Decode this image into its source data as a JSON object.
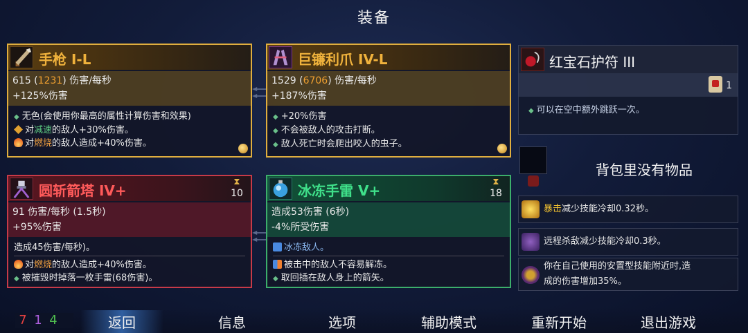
{
  "title": "装备",
  "cards": [
    {
      "name": "手枪 I-L",
      "stat_main": "615",
      "stat_paren": "1231",
      "stat_unit": "伤害/每秒",
      "stat_sub": "+125%伤害",
      "effects": [
        "无色(会使用你最高的属性计算伤害和效果)",
        "对",
        "减速",
        "的敌人+30%伤害。",
        "对",
        "燃烧",
        "的敌人造成+40%伤害。"
      ]
    },
    {
      "name": "巨镰利爪 IV-L",
      "stat_main": "1529",
      "stat_paren": "6706",
      "stat_unit": "伤害/每秒",
      "stat_sub": "+187%伤害",
      "effects": [
        "+20%伤害",
        "不会被敌人的攻击打断。",
        "敌人死亡时会爬出咬人的虫子。"
      ]
    },
    {
      "name": "圆斩箭塔 IV+",
      "timer": "10",
      "stat_main": "91 伤害/每秒 (1.5秒)",
      "stat_sub": "+95%伤害",
      "stat_extra": "造成45伤害/每秒)。",
      "effects": [
        "对",
        "燃烧",
        "的敌人造成+40%伤害。",
        "被摧毁时掉落一枚手雷(68伤害)。"
      ]
    },
    {
      "name": "冰冻手雷 V+",
      "timer": "18",
      "stat_main": "造成53伤害 (6秒)",
      "stat_sub": "-4%所受伤害",
      "stat_extra": "冰冻敌人。",
      "effects": [
        "被击中的敌人不容易解冻。",
        "取回插在敌人身上的箭矢。"
      ]
    }
  ],
  "amulet": {
    "name": "红宝石护符 III",
    "count": "1",
    "effect": "可以在空中额外跳跃一次。"
  },
  "backpack": {
    "empty_text": "背包里没有物品"
  },
  "perks": [
    {
      "keyword": "暴击",
      "text": "减少技能冷却0.32秒。"
    },
    {
      "keyword": "",
      "text": "远程杀敌减少技能冷却0.3秒。"
    },
    {
      "keyword": "",
      "text1": "你在自己使用的安置型技能附近时,造",
      "text2": "成的伤害增加35%。"
    }
  ],
  "stats": {
    "brutality": "7",
    "tactics": "1",
    "survival": "4"
  },
  "nav": [
    "返回",
    "信息",
    "选项",
    "辅助模式",
    "重新开始",
    "退出游戏"
  ],
  "colors": {
    "brutality": "#e04040",
    "tactics": "#b060e0",
    "survival": "#50c050"
  }
}
